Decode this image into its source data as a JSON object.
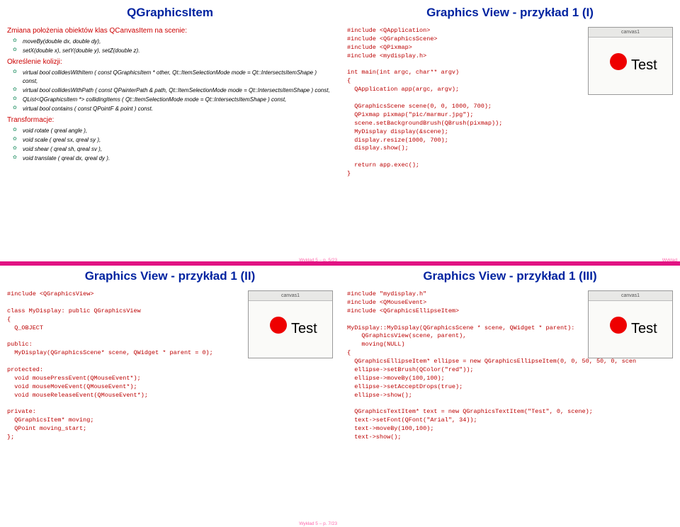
{
  "slides": {
    "tl": {
      "title": "QGraphicsItem",
      "h1": "Zmiana położenia obiektów klas QCanvasItem na scenie:",
      "b1": [
        "moveBy(double dx, double dy),",
        "setX(double x), setY(double y), setZ(double z)."
      ],
      "h2": "Określenie kolizji:",
      "b2": [
        "virtual bool collidesWithItem ( const QGraphicsItem * other, Qt::ItemSelectionMode mode = Qt::IntersectsItemShape ) const,",
        "virtual bool collidesWithPath ( const QPainterPath & path, Qt::ItemSelectionMode mode = Qt::IntersectsItemShape ) const,",
        "QList<QGraphicsItem *> collidingItems ( Qt::ItemSelectionMode mode = Qt::IntersectsItemShape ) const,",
        "virtual bool contains ( const QPointF & point ) const."
      ],
      "h3": "Transformacje:",
      "b3": [
        "void rotate ( qreal angle ),",
        "void scale ( qreal sx, qreal sy ),",
        "void shear ( qreal sh, qreal sv ),",
        "void translate ( qreal dx, qreal dy )."
      ],
      "pager": "Wykład 5 – p. 5/23"
    },
    "tr": {
      "title": "Graphics View - przykład 1 (I)",
      "code": "#include <QApplication>\n#include <QGraphicsScene>\n#include <QPixmap>\n#include <mydisplay.h>\n\nint main(int argc, char** argv)\n{\n  QApplication app(argc, argv);\n\n  QGraphicsScene scene(0, 0, 1000, 700);\n  QPixmap pixmap(\"pic/marmur.jpg\");\n  scene.setBackgroundBrush(QBrush(pixmap));\n  MyDisplay display(&scene);\n  display.resize(1000, 700);\n  display.show();\n\n  return app.exec();\n}",
      "thumb": {
        "bar": "canvas1",
        "label": "Test"
      },
      "pager": "Wykład"
    },
    "bl": {
      "title": "Graphics View - przykład 1 (II)",
      "code": "#include <QGraphicsView>\n\nclass MyDisplay: public QGraphicsView\n{\n  Q_OBJECT\n\npublic:\n  MyDisplay(QGraphicsScene* scene, QWidget * parent = 0);\n\nprotected:\n  void mousePressEvent(QMouseEvent*);\n  void mouseMoveEvent(QMouseEvent*);\n  void mouseReleaseEvent(QMouseEvent*);\n\nprivate:\n  QGraphicsItem* moving;\n  QPoint moving_start;\n};",
      "thumb": {
        "bar": "canvas1",
        "label": "Test"
      },
      "pager": "Wykład 5 – p. 7/23"
    },
    "br": {
      "title": "Graphics View - przykład 1 (III)",
      "code": "#include \"mydisplay.h\"\n#include <QMouseEvent>\n#include <QGraphicsEllipseItem>\n\nMyDisplay::MyDisplay(QGraphicsScene * scene, QWidget * parent):\n    QGraphicsView(scene, parent),\n    moving(NULL)\n{\n  QGraphicsEllipseItem* ellipse = new QGraphicsEllipseItem(0, 0, 50, 50, 0, scen\n  ellipse->setBrush(QColor(\"red\"));\n  ellipse->moveBy(100,100);\n  ellipse->setAcceptDrops(true);\n  ellipse->show();\n\n  QGraphicsTextItem* text = new QGraphicsTextItem(\"Test\", 0, scene);\n  text->setFont(QFont(\"Arial\", 34));\n  text->moveBy(100,100);\n  text->show();\n",
      "thumb": {
        "bar": "canvas1",
        "label": "Test"
      },
      "pager": ""
    }
  }
}
